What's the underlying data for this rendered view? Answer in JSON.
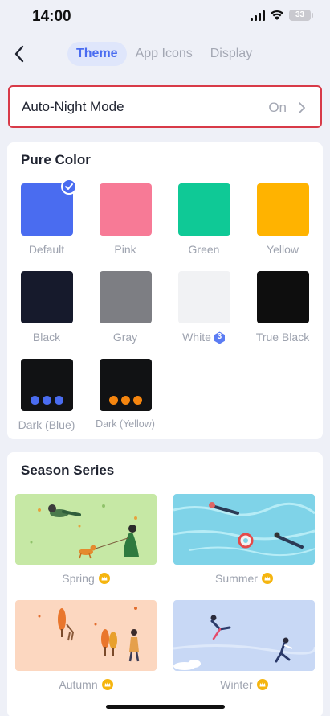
{
  "status": {
    "time": "14:00",
    "battery": "33"
  },
  "tabs": [
    {
      "label": "Theme",
      "active": true
    },
    {
      "label": "App Icons",
      "active": false
    },
    {
      "label": "Display",
      "active": false
    }
  ],
  "auto_night": {
    "label": "Auto-Night Mode",
    "value": "On"
  },
  "pure_color": {
    "title": "Pure Color",
    "items": [
      {
        "label": "Default",
        "color": "#4a6cf0",
        "selected": true
      },
      {
        "label": "Pink",
        "color": "#f77a96"
      },
      {
        "label": "Green",
        "color": "#0fc996"
      },
      {
        "label": "Yellow",
        "color": "#ffb300"
      },
      {
        "label": "Black",
        "color": "#161a2c"
      },
      {
        "label": "Gray",
        "color": "#7d7e83"
      },
      {
        "label": "White",
        "color": "#f1f2f4",
        "badge": "3"
      },
      {
        "label": "True Black",
        "color": "#0e0e0e"
      },
      {
        "label": "Dark (Blue)",
        "color": "#111214",
        "dot_color": "#4a6cf0"
      },
      {
        "label": "Dark (Yellow)",
        "color": "#111214",
        "dot_color": "#f5850f"
      }
    ]
  },
  "season_series": {
    "title": "Season Series",
    "items": [
      {
        "label": "Spring",
        "icon": "crown-icon"
      },
      {
        "label": "Summer",
        "icon": "crown-icon"
      },
      {
        "label": "Autumn",
        "icon": "crown-icon"
      },
      {
        "label": "Winter",
        "icon": "crown-icon"
      }
    ]
  },
  "colors": {
    "accent": "#4a6cf0",
    "highlight_border": "#d83a48",
    "crown": "#f5b50f"
  }
}
